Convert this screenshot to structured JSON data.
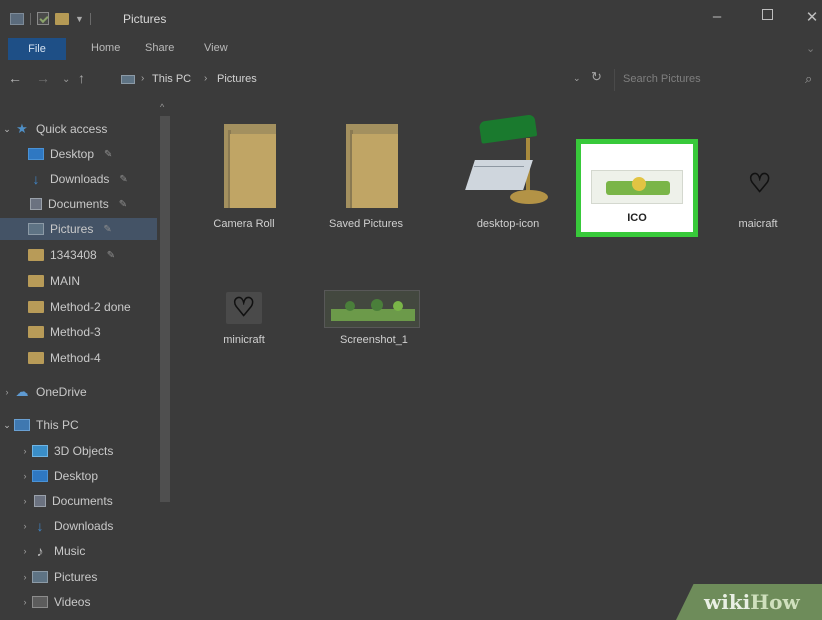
{
  "window": {
    "title": "Pictures",
    "controls": {
      "minimize": "–",
      "maximize": "",
      "close": "✕"
    }
  },
  "ribbon": {
    "tabs": [
      "File",
      "Home",
      "Share",
      "View"
    ]
  },
  "address": {
    "back": "←",
    "forward": "→",
    "recent": "⌄",
    "up": "↑",
    "crumbs": [
      "This PC",
      "Pictures"
    ],
    "separator": "›",
    "dropdown": "⌄",
    "refresh": "↻",
    "search_placeholder": "Search Pictures",
    "search_icon": "⌕"
  },
  "sidebar": {
    "quick_access": "Quick access",
    "quick_items": [
      {
        "label": "Desktop",
        "pinned": true
      },
      {
        "label": "Downloads",
        "pinned": true
      },
      {
        "label": "Documents",
        "pinned": true
      },
      {
        "label": "Pictures",
        "pinned": true,
        "selected": true
      },
      {
        "label": "1343408",
        "pinned": true
      },
      {
        "label": "MAIN",
        "pinned": false
      },
      {
        "label": "Method-2 done",
        "pinned": false
      },
      {
        "label": "Method-3",
        "pinned": false
      },
      {
        "label": "Method-4",
        "pinned": false
      }
    ],
    "onedrive": "OneDrive",
    "this_pc": "This PC",
    "pc_items": [
      "3D Objects",
      "Desktop",
      "Documents",
      "Downloads",
      "Music",
      "Pictures",
      "Videos"
    ],
    "pin_glyph": "✎",
    "collapse_glyph": "›",
    "expand_glyph": "⌄",
    "scroll_up": "^"
  },
  "content": {
    "items": [
      {
        "name": "Camera Roll",
        "kind": "folder"
      },
      {
        "name": "Saved Pictures",
        "kind": "folder"
      },
      {
        "name": "desktop-icon",
        "kind": "image"
      },
      {
        "name": "ICO",
        "kind": "image",
        "selected": true
      },
      {
        "name": "maicraft",
        "kind": "image"
      },
      {
        "name": "minicraft",
        "kind": "image"
      },
      {
        "name": "Screenshot_1",
        "kind": "image"
      }
    ],
    "heart_glyph": "♡"
  },
  "watermark": {
    "part1": "wiki",
    "part2": "How"
  },
  "colors": {
    "accent": "#1e4f86",
    "selection_border": "#38c93a",
    "folder": "#c0a565",
    "sidebar_selected": "#445366"
  }
}
